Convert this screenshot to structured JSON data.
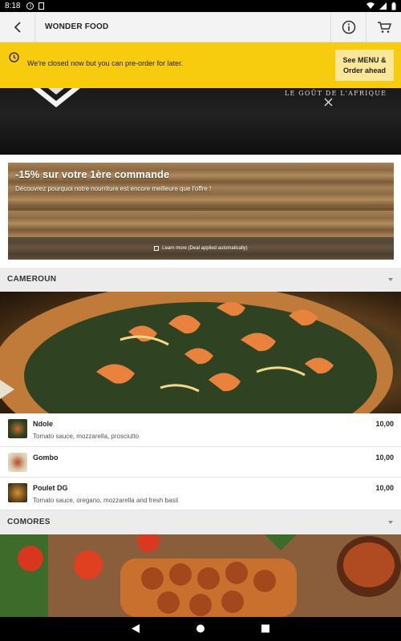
{
  "status_bar": {
    "time": "8:18"
  },
  "app_bar": {
    "title": "WONDER FOOD"
  },
  "notice": {
    "message": "We're closed now but you can pre-order for later.",
    "cta_line1": "See MENU &",
    "cta_line2": "Order ahead"
  },
  "hero": {
    "tagline": "LE GOÛT DE L'AFRIQUE"
  },
  "deal": {
    "title": "-15% sur votre 1ère commande",
    "subtitle": "Découvrez pourquoi notre nourriture est encore meilleure que l'offre !",
    "learn_more": "Learn more (Deal applied automatically)"
  },
  "sections": [
    {
      "name": "CAMEROUN",
      "items": [
        {
          "name": "Ndole",
          "description": "Tomato sauce, mozzarella, prosciutto",
          "price": "10,00"
        },
        {
          "name": "Gombo",
          "description": "",
          "price": "10,00"
        },
        {
          "name": "Poulet DG",
          "description": "Tomato sauce, oregano, mozzarella and fresh basil",
          "price": "10,00"
        }
      ]
    },
    {
      "name": "COMORES",
      "items": []
    }
  ],
  "colors": {
    "accent": "#f7cc0f",
    "cta_bg": "#fbe69a",
    "section_bg": "#ececec"
  },
  "icons": {
    "back": "chevron-left-icon",
    "info": "info-icon",
    "cart": "cart-icon",
    "clock": "clock-icon",
    "nav_back": "triangle-back-icon",
    "nav_home": "circle-home-icon",
    "nav_recents": "square-recents-icon"
  }
}
